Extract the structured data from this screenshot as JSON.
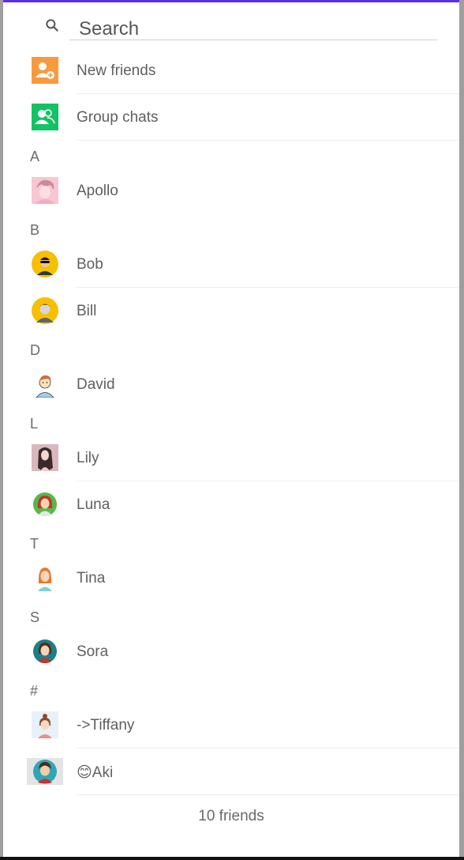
{
  "search": {
    "placeholder": "Search",
    "icon": "search-icon"
  },
  "shortcuts": [
    {
      "label": "New friends",
      "icon": "add-friend-icon",
      "color": "#f79a3e"
    },
    {
      "label": "Group chats",
      "icon": "group-icon",
      "color": "#13c265"
    }
  ],
  "sections": [
    {
      "letter": "A",
      "contacts": [
        {
          "name": "Apollo",
          "avatar": "apollo-avatar"
        }
      ]
    },
    {
      "letter": "B",
      "contacts": [
        {
          "name": "Bob",
          "avatar": "bob-avatar"
        },
        {
          "name": "Bill",
          "avatar": "bill-avatar"
        }
      ]
    },
    {
      "letter": "D",
      "contacts": [
        {
          "name": "David",
          "avatar": "david-avatar"
        }
      ]
    },
    {
      "letter": "L",
      "contacts": [
        {
          "name": "Lily",
          "avatar": "lily-avatar"
        },
        {
          "name": "Luna",
          "avatar": "luna-avatar"
        }
      ]
    },
    {
      "letter": "T",
      "contacts": [
        {
          "name": "Tina",
          "avatar": "tina-avatar"
        }
      ]
    },
    {
      "letter": "S",
      "contacts": [
        {
          "name": "Sora",
          "avatar": "sora-avatar"
        }
      ]
    },
    {
      "letter": "#",
      "contacts": [
        {
          "name": "->Tiffany",
          "avatar": "tiffany-avatar"
        },
        {
          "name": "😊Aki",
          "avatar": "aki-avatar"
        }
      ]
    }
  ],
  "footer": {
    "count_text": "10 friends"
  },
  "colors": {
    "accent": "#5b2ee8",
    "text": "#5f5f5f"
  }
}
